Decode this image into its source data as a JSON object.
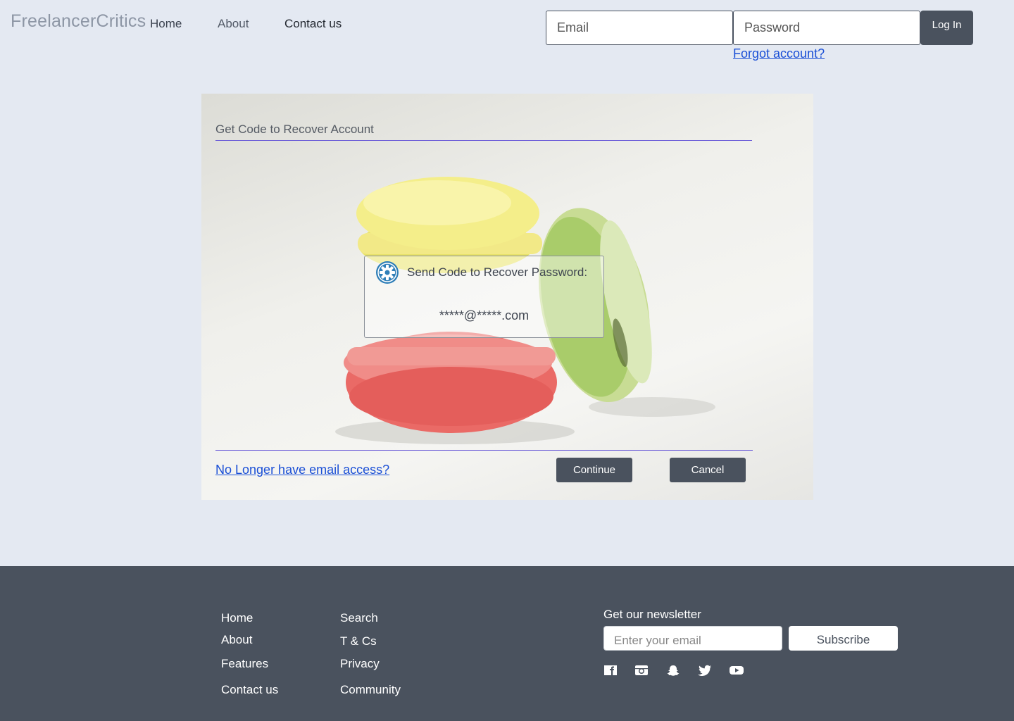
{
  "header": {
    "logo": "FreelancerCritics",
    "nav": [
      {
        "label": "Home"
      },
      {
        "label": "About"
      },
      {
        "label": "Contact us"
      }
    ],
    "login": {
      "email_placeholder": "Email",
      "password_placeholder": "Password",
      "login_label": "Log In",
      "forgot_label": "Forgot account?"
    }
  },
  "recovery": {
    "title": "Get Code to Recover Account",
    "option_label": "Send Code to Recover Password:",
    "masked_email": "*****@*****.com",
    "no_access_label": "No Longer have email access?",
    "continue_label": "Continue",
    "cancel_label": "Cancel"
  },
  "footer": {
    "col1": [
      {
        "label": "Home"
      },
      {
        "label": "About"
      },
      {
        "label": "Features"
      },
      {
        "label": "Contact us"
      }
    ],
    "col2": [
      {
        "label": "Search"
      },
      {
        "label": "T & Cs"
      },
      {
        "label": "Privacy"
      },
      {
        "label": "Community"
      }
    ],
    "newsletter": {
      "title": "Get our newsletter",
      "placeholder": "Enter your email",
      "subscribe_label": "Subscribe"
    },
    "social_icons": [
      "facebook-icon",
      "instagram-icon",
      "snapchat-icon",
      "twitter-icon",
      "youtube-icon"
    ]
  },
  "colors": {
    "page_bg": "#e4e9f2",
    "footer_bg": "#4a525e",
    "button_dark": "#4a525e",
    "link": "#1a4fd6",
    "divider": "#6a5bd8",
    "gear_icon": "#2f7fb8"
  }
}
